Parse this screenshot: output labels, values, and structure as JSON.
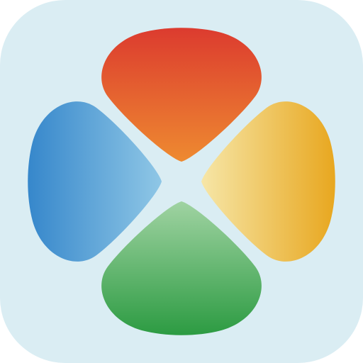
{
  "icon": {
    "name": "four-petal-clover-logo",
    "background_color": "#daedf3",
    "petals": [
      {
        "name": "red-petal",
        "position": "top",
        "colors": [
          "#dc3b2f",
          "#ee8a30"
        ]
      },
      {
        "name": "yellow-petal",
        "position": "right",
        "colors": [
          "#f6e6a7",
          "#e8a71f"
        ]
      },
      {
        "name": "green-petal",
        "position": "bottom",
        "colors": [
          "#a0d3a2",
          "#2c9b42"
        ]
      },
      {
        "name": "blue-petal",
        "position": "left",
        "colors": [
          "#3687cb",
          "#8fc7e6"
        ]
      }
    ]
  }
}
